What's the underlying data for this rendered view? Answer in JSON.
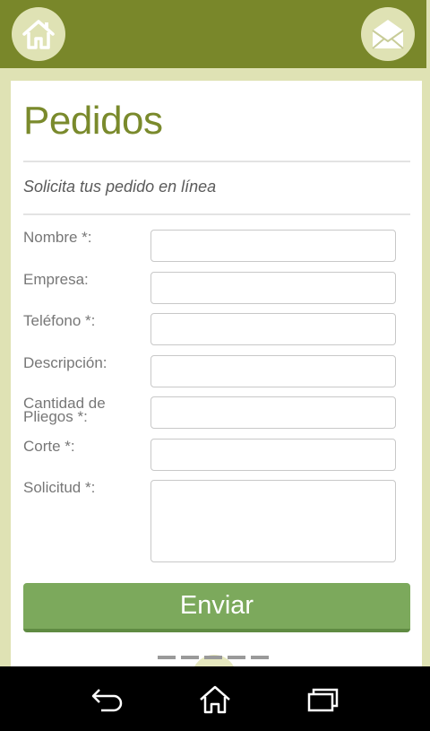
{
  "header": {
    "home_icon": "home-icon",
    "mail_icon": "mail-icon"
  },
  "page": {
    "title": "Pedidos",
    "subtitle": "Solicita tus pedido en línea"
  },
  "form": {
    "fields": [
      {
        "label": "Nombre *:",
        "value": ""
      },
      {
        "label": "Empresa:",
        "value": ""
      },
      {
        "label": "Teléfono *:",
        "value": ""
      },
      {
        "label": "Descripción:",
        "value": ""
      },
      {
        "label": "Cantidad de Pliegos *:",
        "value": ""
      },
      {
        "label": "Corte *:",
        "value": ""
      },
      {
        "label": "Solicitud *:",
        "value": ""
      }
    ],
    "submit_label": "Enviar"
  },
  "pager": {
    "count": 5,
    "active": 3
  },
  "system_nav": {
    "back_icon": "back-icon",
    "home_icon": "home-outline-icon",
    "recent_icon": "recent-apps-icon"
  },
  "colors": {
    "header": "#79872a",
    "accent": "#7a8a2c",
    "button": "#7ca95c",
    "background": "#dfe2b4"
  }
}
